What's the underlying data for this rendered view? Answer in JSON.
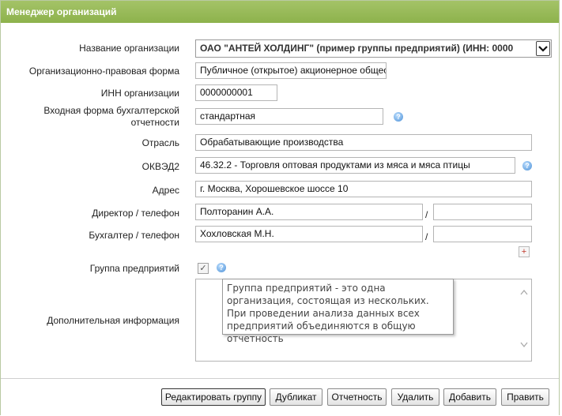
{
  "header": {
    "title": "Менеджер организаций"
  },
  "form": {
    "org_name": {
      "label": "Название организации",
      "value": "ОАО \"АНТЕЙ ХОЛДИНГ\" (пример группы предприятий)     (ИНН: 0000"
    },
    "legal_form": {
      "label": "Организационно-правовая форма",
      "value": "Публичное (открытое) акционерное общество"
    },
    "inn": {
      "label": "ИНН организации",
      "value": "0000000001"
    },
    "report_form": {
      "label_line1": "Входная форма бухгалтерской",
      "label_line2": "отчетности",
      "value": "стандартная"
    },
    "industry": {
      "label": "Отрасль",
      "value": "Обрабатывающие производства"
    },
    "okved": {
      "label": "ОКВЭД2",
      "value": "46.32.2 - Торговля оптовая продуктами из мяса и мяса птицы"
    },
    "address": {
      "label": "Адрес",
      "value": "г. Москва, Хорошевское шоссе 10"
    },
    "director": {
      "label": "Директор / телефон",
      "name": "Полторанин А.А.",
      "phone": "",
      "separator": "/"
    },
    "accountant": {
      "label": "Бухгалтер / телефон",
      "name": "Хохловская М.Н.",
      "phone": "",
      "separator": "/"
    },
    "add_symbol": "+",
    "group": {
      "label": "Группа предприятий",
      "checked_mark": "✓"
    },
    "extra_info": {
      "label": "Дополнительная информация",
      "value": ""
    },
    "tooltip": {
      "text": "Группа предприятий - это одна организация, состоящая из нескольких. При проведении анализа данных всех предприятий объединяются в общую отчетность"
    },
    "help_symbol": "?"
  },
  "buttons": {
    "edit_group": "Редактировать группу",
    "duplicate": "Дубликат",
    "report": "Отчетность",
    "delete": "Удалить",
    "add": "Добавить",
    "edit": "Править"
  },
  "colors": {
    "header_bg": "#95b955",
    "help_icon": "#4a8fd6"
  }
}
